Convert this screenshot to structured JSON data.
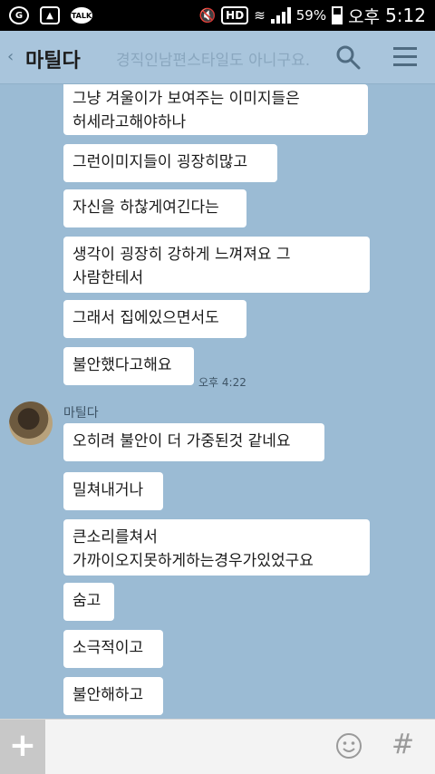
{
  "status_bar": {
    "battery": "59%",
    "ampm": "오후",
    "time": "5:12",
    "hd": "HD",
    "talk": "TALK"
  },
  "header": {
    "title": "마틸다",
    "ghost_text": "경직인남편스타일도 아니구요."
  },
  "messages": [
    {
      "text": "그냥 겨울이가 보여주는 이미지들은\n허세라고해야하나"
    },
    {
      "text": "그런이미지들이 굉장히많고"
    },
    {
      "text": "자신을 하찮게여긴다는"
    },
    {
      "text": "생각이 굉장히 강하게 느껴져요 그\n사람한테서"
    },
    {
      "text": "그래서 집에있으면서도"
    },
    {
      "text": "불안했다고해요"
    },
    {
      "text": "오히려 불안이 더 가중된것 같네요"
    },
    {
      "text": "밀쳐내거나"
    },
    {
      "text": "큰소리를쳐서\n가까이오지못하게하는경우가있었구요"
    },
    {
      "text": "숨고"
    },
    {
      "text": "소극적이고"
    },
    {
      "text": "불안해하고"
    }
  ],
  "timestamp": "오후 4:22",
  "sender_name": "마틸다",
  "input": {
    "placeholder": "",
    "plus_label": "+",
    "hash_label": "#"
  },
  "colors": {
    "chat_background": "#9bbbd4",
    "bubble": "#ffffff",
    "header": "#a9c5dc"
  }
}
